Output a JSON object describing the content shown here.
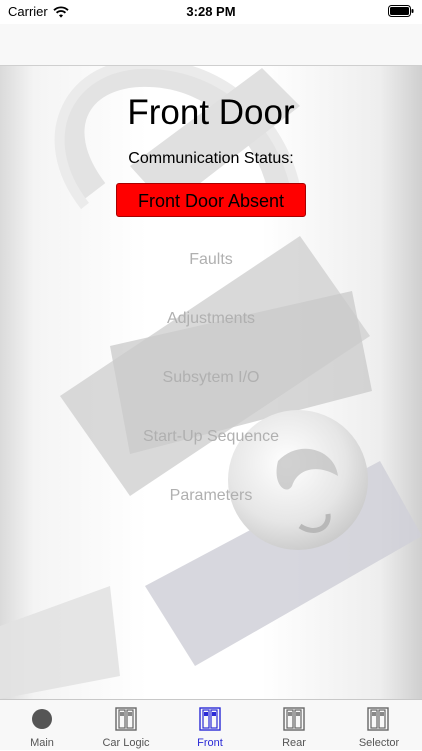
{
  "status_bar": {
    "carrier": "Carrier",
    "time": "3:28 PM",
    "icons": [
      "wifi-icon",
      "battery-icon"
    ]
  },
  "content": {
    "title": "Front Door",
    "comm_label": "Communication Status:",
    "comm_status": "Front Door Absent",
    "status_color": "#ff0000",
    "menu": [
      {
        "label": "Faults"
      },
      {
        "label": "Adjustments"
      },
      {
        "label": "Subsytem I/O"
      },
      {
        "label": "Start-Up Sequence"
      },
      {
        "label": "Parameters"
      }
    ],
    "menu_color": "#b0b0b0"
  },
  "tabs": [
    {
      "label": "Main",
      "icon": "circle-icon",
      "active": false
    },
    {
      "label": "Car Logic",
      "icon": "elevator-icon",
      "active": false
    },
    {
      "label": "Front",
      "icon": "elevator-icon",
      "active": true
    },
    {
      "label": "Rear",
      "icon": "elevator-icon",
      "active": false
    },
    {
      "label": "Selector",
      "icon": "elevator-icon",
      "active": false
    }
  ],
  "accent_color": "#2b2bd6"
}
